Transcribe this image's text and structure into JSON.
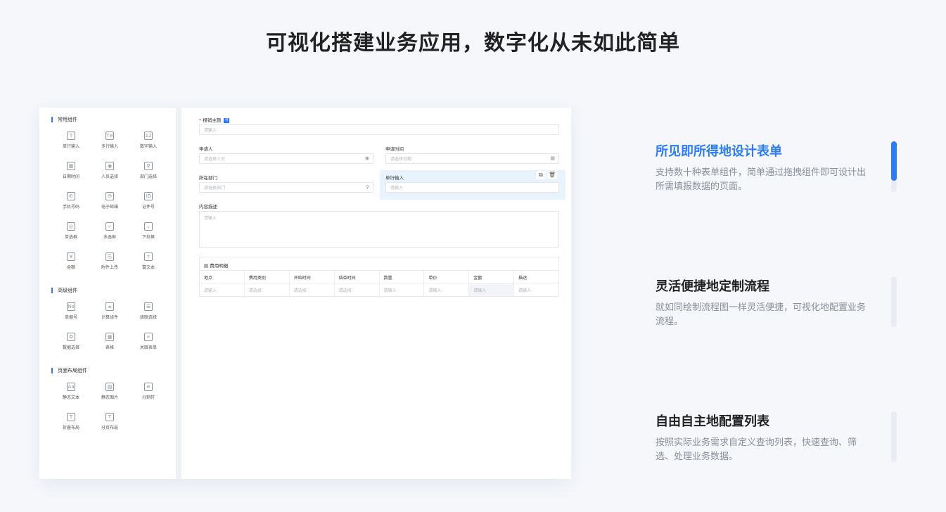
{
  "headline": "可视化搭建业务应用，数字化从未如此简单",
  "palette": {
    "sections": [
      {
        "title": "常用组件",
        "items": [
          {
            "label": "单行输入",
            "glyph": "T"
          },
          {
            "label": "多行输入",
            "glyph": "T≡"
          },
          {
            "label": "数字输入",
            "glyph": "12"
          },
          {
            "label": "日期时间",
            "glyph": "▦"
          },
          {
            "label": "人员选择",
            "glyph": "◉"
          },
          {
            "label": "部门选择",
            "glyph": "⚲"
          },
          {
            "label": "手机号码",
            "glyph": "✆"
          },
          {
            "label": "电子邮箱",
            "glyph": "✉"
          },
          {
            "label": "证件号",
            "glyph": "ID"
          },
          {
            "label": "单选框",
            "glyph": "◎"
          },
          {
            "label": "多选框",
            "glyph": "✓"
          },
          {
            "label": "下拉框",
            "glyph": "⌄"
          },
          {
            "label": "金额",
            "glyph": "¥"
          },
          {
            "label": "附件上传",
            "glyph": "⎘"
          },
          {
            "label": "富文本",
            "glyph": "⌗"
          }
        ]
      },
      {
        "title": "高级组件",
        "items": [
          {
            "label": "单据号",
            "glyph": "No"
          },
          {
            "label": "计算组件",
            "glyph": "±"
          },
          {
            "label": "级联选择",
            "glyph": "☰"
          },
          {
            "label": "数据选择",
            "glyph": "⧉"
          },
          {
            "label": "表格",
            "glyph": "▦"
          },
          {
            "label": "关联表单",
            "glyph": "∞"
          }
        ]
      },
      {
        "title": "页面布局组件",
        "items": [
          {
            "label": "静态文本",
            "glyph": "Aa"
          },
          {
            "label": "静态图片",
            "glyph": "▨"
          },
          {
            "label": "分割符",
            "glyph": "≡"
          },
          {
            "label": "折叠布局",
            "glyph": "T"
          },
          {
            "label": "分页布局",
            "glyph": "T"
          }
        ]
      }
    ]
  },
  "form": {
    "subject_label": "报销主题",
    "subject_badge": "H",
    "subject_placeholder": "请输入",
    "applicant_label": "申请人",
    "applicant_placeholder": "请选择人员",
    "apply_time_label": "申请时间",
    "apply_time_placeholder": "请选择日期",
    "dept_label": "所在部门",
    "dept_placeholder": "请选择部门",
    "single_input_label": "单行输入",
    "single_input_placeholder": "请输入",
    "desc_label": "内容描述",
    "desc_placeholder": "请输入",
    "table_caption": "费用明细",
    "table_headers": [
      "地点",
      "费用类别",
      "开始时间",
      "结束时间",
      "数量",
      "单价",
      "金额",
      "描述"
    ],
    "table_placeholders": [
      "请输入",
      "请选择",
      "请选择",
      "请选择",
      "请输入",
      "请输入",
      "请输入",
      "请输入"
    ]
  },
  "features": [
    {
      "title": "所见即所得地设计表单",
      "desc": "支持数十种表单组件，简单通过拖拽组件即可设计出所需填报数据的页面。",
      "active": true
    },
    {
      "title": "灵活便捷地定制流程",
      "desc": "就如同绘制流程图一样灵活便捷，可视化地配置业务流程。",
      "active": false
    },
    {
      "title": "自由自主地配置列表",
      "desc": "按照实际业务需求自定义查询列表，快速查询、筛选、处理业务数据。",
      "active": false
    }
  ],
  "colors": {
    "accent": "#2b7cf6",
    "selection": "#e8f3fd"
  }
}
